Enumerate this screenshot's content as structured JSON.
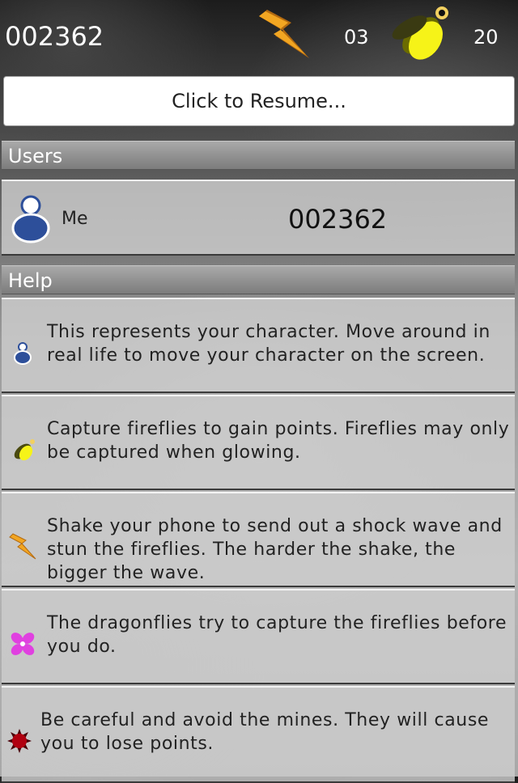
{
  "header": {
    "score": "002362",
    "shock_count": "03",
    "firefly_count": "20",
    "shock_icon": "lightning-bolt-icon",
    "firefly_icon": "firefly-icon"
  },
  "resume_button": {
    "label": "Click to Resume..."
  },
  "users_section": {
    "title": "Users",
    "users": [
      {
        "name": "Me",
        "score": "002362",
        "icon": "user-avatar-icon"
      }
    ]
  },
  "help_section": {
    "title": "Help",
    "items": [
      {
        "icon": "character-icon",
        "text": "This represents your character.  Move around in real life to move your character on the screen."
      },
      {
        "icon": "firefly-icon",
        "text": "Capture fireflies to gain points. Fireflies may only be captured when glowing."
      },
      {
        "icon": "lightning-bolt-icon",
        "text": "Shake your phone to send out a shock wave and stun the fireflies.  The harder the shake, the bigger the wave."
      },
      {
        "icon": "dragonfly-icon",
        "text": "The dragonflies try to capture the fireflies before you do."
      },
      {
        "icon": "mine-icon",
        "text": "Be careful and avoid the mines. They will cause you to lose points."
      }
    ]
  },
  "colors": {
    "firefly_glow": "#f3f315",
    "bolt": "#f0a020",
    "avatar_blue": "#2d4f9a",
    "dragonfly": "#e040e0",
    "mine": "#b00010"
  }
}
